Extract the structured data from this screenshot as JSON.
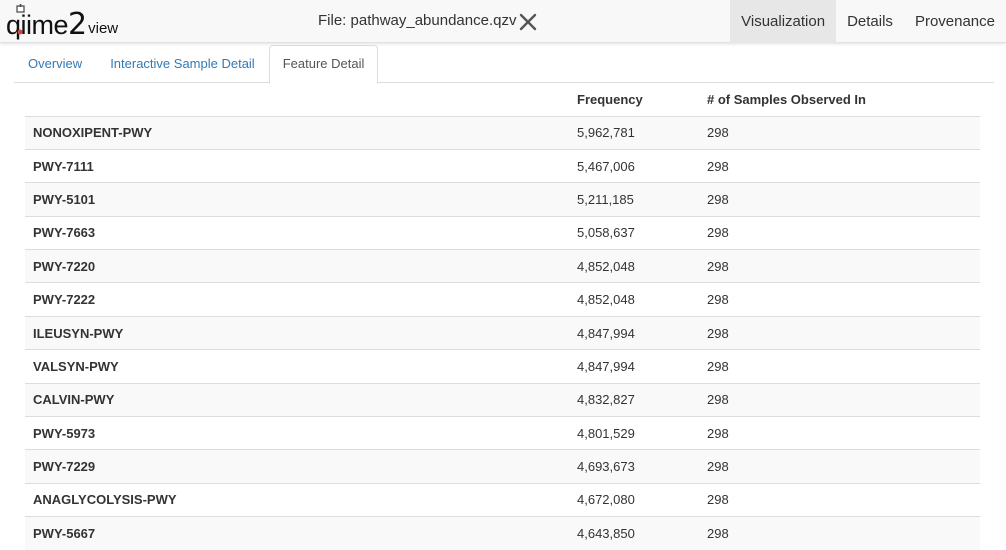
{
  "brand": {
    "q": "qiime",
    "two": "2",
    "view": "view"
  },
  "header": {
    "file_title": "File: pathway_abundance.qzv",
    "close_icon": "close-icon"
  },
  "nav": {
    "tabs": [
      "Visualization",
      "Details",
      "Provenance"
    ],
    "active": "Visualization"
  },
  "subtabs": {
    "items": [
      "Overview",
      "Interactive Sample Detail",
      "Feature Detail"
    ],
    "active": "Feature Detail"
  },
  "table": {
    "columns": [
      "",
      "Frequency",
      "# of Samples Observed In"
    ],
    "rows": [
      {
        "feature": "NONOXIPENT-PWY",
        "frequency": "5,962,781",
        "samples": "298"
      },
      {
        "feature": "PWY-7111",
        "frequency": "5,467,006",
        "samples": "298"
      },
      {
        "feature": "PWY-5101",
        "frequency": "5,211,185",
        "samples": "298"
      },
      {
        "feature": "PWY-7663",
        "frequency": "5,058,637",
        "samples": "298"
      },
      {
        "feature": "PWY-7220",
        "frequency": "4,852,048",
        "samples": "298"
      },
      {
        "feature": "PWY-7222",
        "frequency": "4,852,048",
        "samples": "298"
      },
      {
        "feature": "ILEUSYN-PWY",
        "frequency": "4,847,994",
        "samples": "298"
      },
      {
        "feature": "VALSYN-PWY",
        "frequency": "4,847,994",
        "samples": "298"
      },
      {
        "feature": "CALVIN-PWY",
        "frequency": "4,832,827",
        "samples": "298"
      },
      {
        "feature": "PWY-5973",
        "frequency": "4,801,529",
        "samples": "298"
      },
      {
        "feature": "PWY-7229",
        "frequency": "4,693,673",
        "samples": "298"
      },
      {
        "feature": "ANAGLYCOLYSIS-PWY",
        "frequency": "4,672,080",
        "samples": "298"
      },
      {
        "feature": "PWY-5667",
        "frequency": "4,643,850",
        "samples": "298"
      }
    ]
  },
  "colors": {
    "link": "#337ab7",
    "navbar_bg": "#f8f8f8",
    "active_tab_bg": "#e7e7e7",
    "stripe": "#f9f9f9"
  }
}
